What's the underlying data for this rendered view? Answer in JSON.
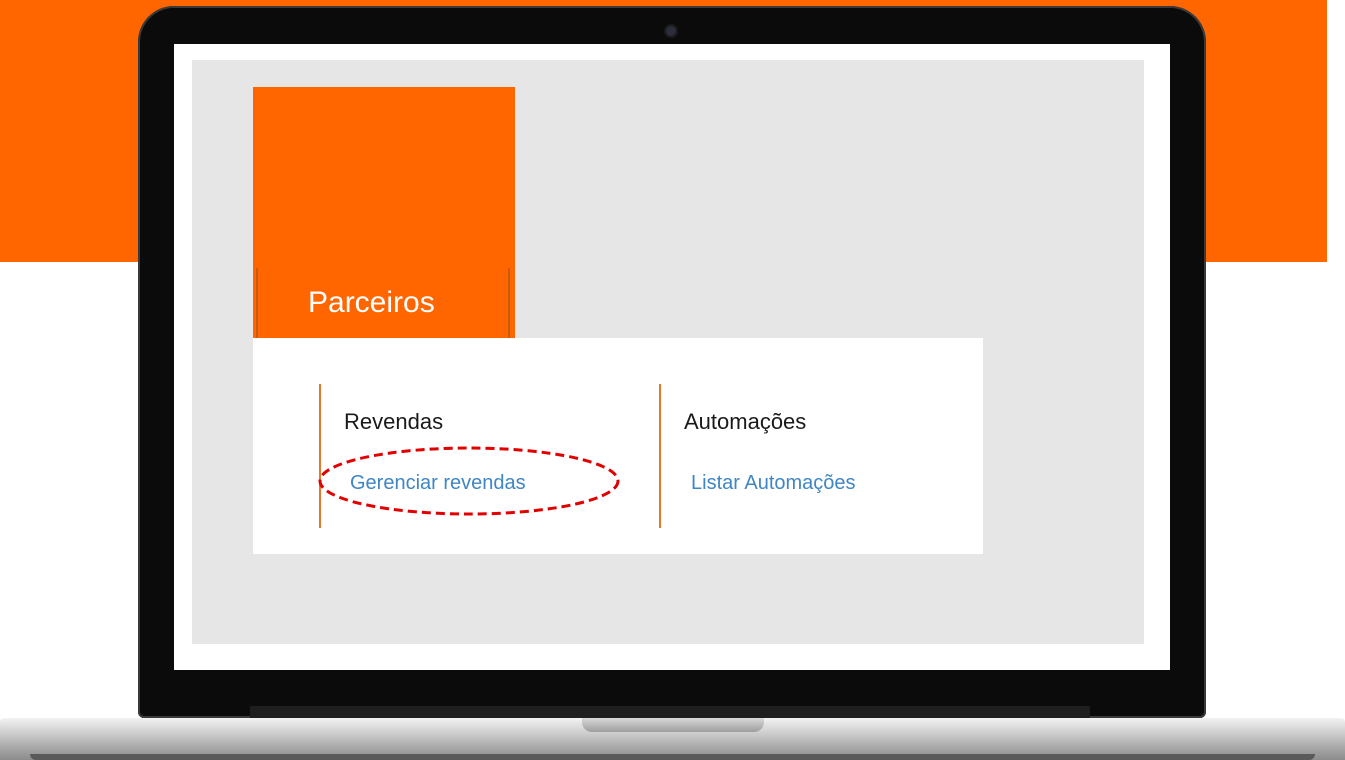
{
  "tile": {
    "title": "Parceiros"
  },
  "menu": {
    "columns": [
      {
        "heading": "Revendas",
        "link": "Gerenciar revendas"
      },
      {
        "heading": "Automações",
        "link": "Listar Automações"
      }
    ]
  },
  "colors": {
    "brand_orange": "#ff6600",
    "link_blue": "#3f86c4",
    "highlight_red": "#e00000",
    "app_background": "#e6e6e6"
  }
}
